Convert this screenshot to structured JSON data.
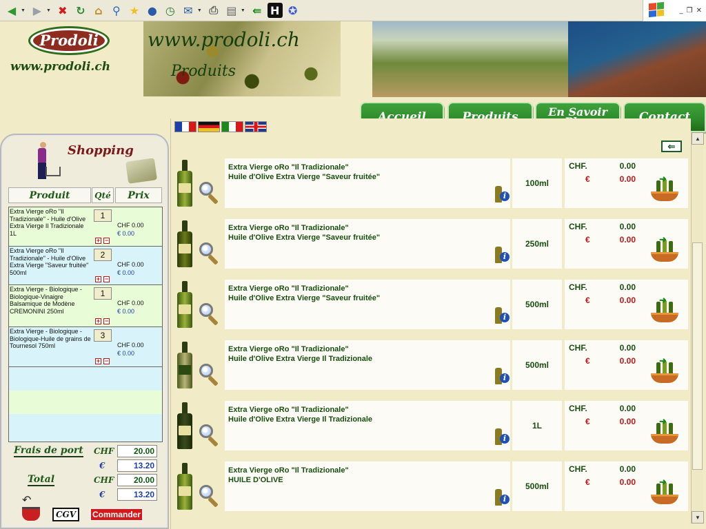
{
  "toolbar": {
    "icons": [
      "back-icon",
      "forward-icon",
      "stop-icon",
      "refresh-icon",
      "home-icon",
      "search-icon",
      "favorites-icon",
      "media-icon",
      "history-icon",
      "mail-icon",
      "print-icon",
      "edit-icon",
      "messenger-icon",
      "h-icon",
      "discuss-icon"
    ],
    "colors": {
      "back": "#2e9a2e",
      "forward": "#9aa0a8",
      "stop": "#d81818",
      "refresh": "#2e8a2e",
      "home": "#c88a2a",
      "search": "#2a6ac8",
      "favorites": "#f0c020",
      "media": "#2a5aa8",
      "history": "#2a7a3a",
      "mail": "#2a5aa8",
      "print": "#666666",
      "edit": "#666666",
      "messenger": "#1d8a1d",
      "h": "#111111",
      "discuss": "#3a5ad8"
    }
  },
  "window": {
    "minimize": "_",
    "restore": "❐",
    "close": "✕"
  },
  "header": {
    "logo_text": "Prodoli",
    "logo_url": "www.prodoli.ch",
    "banner_url": "www.prodoli.ch",
    "banner_title": "Produits"
  },
  "nav": [
    "Accueil",
    "Produits",
    "En Savoir Plus",
    "Contact"
  ],
  "languages": [
    "fr",
    "de",
    "it",
    "en"
  ],
  "products": [
    {
      "line1": "Extra Vierge oRo \"Il Tradizionale\"",
      "line2": "Huile d'Olive Extra Vierge \"Saveur fruitée\"",
      "size": "100ml",
      "chf_label": "CHF.",
      "chf": "0.00",
      "eur_label": "€",
      "eur": "0.00"
    },
    {
      "line1": "Extra Vierge oRo \"Il Tradizionale\"",
      "line2": "Huile d'Olive Extra Vierge \"Saveur fruitée\"",
      "size": "250ml",
      "chf_label": "CHF.",
      "chf": "0.00",
      "eur_label": "€",
      "eur": "0.00"
    },
    {
      "line1": "Extra Vierge oRo \"Il Tradizionale\"",
      "line2": "Huile d'Olive Extra Vierge \"Saveur fruitée\"",
      "size": "500ml",
      "chf_label": "CHF.",
      "chf": "0.00",
      "eur_label": "€",
      "eur": "0.00"
    },
    {
      "line1": "Extra Vierge oRo \"Il Tradizionale\"",
      "line2": "Huile d'Olive Extra Vierge Il Tradizionale",
      "size": "500ml",
      "chf_label": "CHF.",
      "chf": "0.00",
      "eur_label": "€",
      "eur": "0.00"
    },
    {
      "line1": "Extra Vierge oRo \"Il Tradizionale\"",
      "line2": "Huile d'Olive Extra Vierge Il Tradizionale",
      "size": "1L",
      "chf_label": "CHF.",
      "chf": "0.00",
      "eur_label": "€",
      "eur": "0.00"
    },
    {
      "line1": "Extra Vierge oRo \"Il Tradizionale\"",
      "line2": "HUILE D'OLIVE",
      "size": "500ml",
      "chf_label": "CHF.",
      "chf": "0.00",
      "eur_label": "€",
      "eur": "0.00"
    }
  ],
  "cart": {
    "title": "Shopping",
    "col_produit": "Produit",
    "col_qte": "Qté",
    "col_prix": "Prix",
    "items": [
      {
        "name": "Extra Vierge oRo \"Il Tradizionale\" - Huile d'Olive Extra Vierge Il Tradizionale 1L",
        "qty": "1",
        "chf": "CHF 0.00",
        "eur": "€  0.00"
      },
      {
        "name": "Extra Vierge oRo \"Il Tradizionale\" - Huile d'Olive Extra Vierge \"Saveur fruitée\" 500ml",
        "qty": "2",
        "chf": "CHF 0.00",
        "eur": "€  0.00"
      },
      {
        "name": "Extra Vierge - Biologique - Biologique-Vinaigre Balsamique de Modène CREMONINI 250ml",
        "qty": "1",
        "chf": "CHF 0.00",
        "eur": "€  0.00"
      },
      {
        "name": "Extra Vierge - Biologique - Biologique-Huile de grains de Tournesol 750ml",
        "qty": "3",
        "chf": "CHF 0.00",
        "eur": "€  0.00"
      }
    ],
    "frais_label": "Frais de port",
    "total_label": "Total",
    "chf_label": "CHF",
    "eur_label": "€",
    "frais_chf": "20.00",
    "frais_eur": "13.20",
    "total_chf": "20.00",
    "total_eur": "13.20",
    "cgv": "CGV",
    "commander": "Commander"
  }
}
